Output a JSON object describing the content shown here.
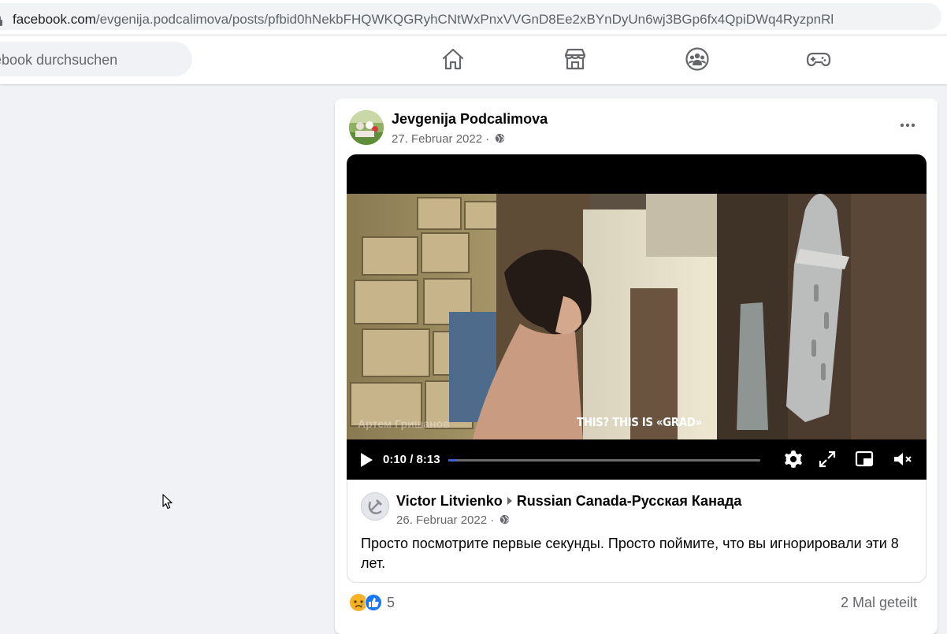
{
  "browser": {
    "url_domain": "facebook.com",
    "url_path": "/evgenija.podcalimova/posts/pfbid0hNekbFHQWKQGRyhCNtWxPnxVVGnD8Ee2xBYnDyUn6wj3BGp6fx4QpiDWq4RyzpnRl"
  },
  "header": {
    "search_placeholder": "ebook durchsuchen",
    "nav": [
      "home-icon",
      "marketplace-icon",
      "groups-icon",
      "gaming-icon"
    ]
  },
  "post": {
    "author": "Jevgenija Podcalimova",
    "date": "27. Februar 2022 ·",
    "video": {
      "subtitle": "THIS? THIS IS «GRAD»",
      "watermark": "Артем Гришанов",
      "time": "0:10 / 8:13",
      "progress": 0.02
    },
    "shared": {
      "author": "Victor Litvienko",
      "group": "Russian Canada-Русская Канада",
      "date": "26. Februar 2022 ·",
      "text": "Просто посмотрите первые секунды. Просто поймите, что вы игнорировали эти  8 лет."
    },
    "reaction_count": "5",
    "shares": "2 Mal geteilt"
  },
  "colors": {
    "accent": "#1877f2",
    "page_bg": "#f0f2f5"
  }
}
